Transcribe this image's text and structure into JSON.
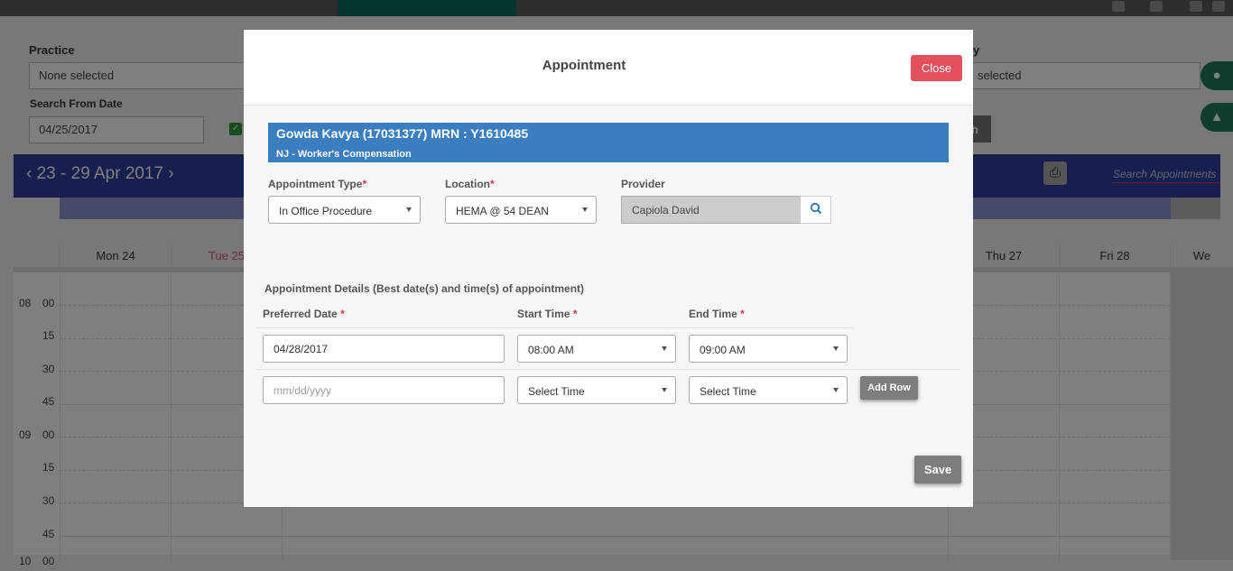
{
  "background": {
    "practice_label": "Practice",
    "practice_value": "None selected",
    "search_from_date_label": "Search From Date",
    "search_from_date_value": "04/25/2017",
    "right_filter_label": "y",
    "right_filter_value": "selected",
    "search_button_partial": "h",
    "calendar": {
      "range": "23 - 29 Apr 2017",
      "prev_icon": "chevron-left-icon",
      "next_icon": "chevron-right-icon",
      "search_placeholder": "Search Appointments",
      "days": [
        {
          "label": "Mon 24",
          "color": "#333333"
        },
        {
          "label": "Tue 25",
          "color": "#e05a6a"
        },
        {
          "label": "Thu 27",
          "color": "#333333"
        },
        {
          "label": "Fri 28",
          "color": "#333333"
        },
        {
          "label": "We",
          "color": "#333333"
        }
      ],
      "times": [
        {
          "hour": "08",
          "min": "00"
        },
        {
          "hour": "",
          "min": "15"
        },
        {
          "hour": "",
          "min": "30"
        },
        {
          "hour": "",
          "min": "45"
        },
        {
          "hour": "09",
          "min": "00"
        },
        {
          "hour": "",
          "min": "15"
        },
        {
          "hour": "",
          "min": "30"
        },
        {
          "hour": "",
          "min": "45"
        },
        {
          "hour": "10",
          "min": "00"
        }
      ]
    }
  },
  "modal": {
    "title": "Appointment",
    "close_label": "Close",
    "patient": {
      "name_line": "Gowda Kavya (17031377) MRN : Y1610485",
      "plan": "NJ - Worker's Compensation"
    },
    "appointment_type": {
      "label": "Appointment Type",
      "value": "In Office Procedure"
    },
    "location": {
      "label": "Location",
      "value": "HEMA @ 54 DEAN"
    },
    "provider": {
      "label": "Provider",
      "value": "Capiola David"
    },
    "details_heading": "Appointment Details (Best date(s) and time(s) of appointment)",
    "columns": {
      "preferred_date": "Preferred Date",
      "start_time": "Start Time",
      "end_time": "End Time"
    },
    "rows": [
      {
        "date": "04/28/2017",
        "start": "08:00 AM",
        "end": "09:00 AM"
      },
      {
        "date_placeholder": "mm/dd/yyyy",
        "start": "Select Time",
        "end": "Select Time"
      }
    ],
    "add_row_label": "Add Row",
    "save_label": "Save"
  },
  "colors": {
    "accent_blue": "#3a7ec0",
    "close_red": "#e4505c",
    "calendar_header": "#2c3e9c"
  }
}
